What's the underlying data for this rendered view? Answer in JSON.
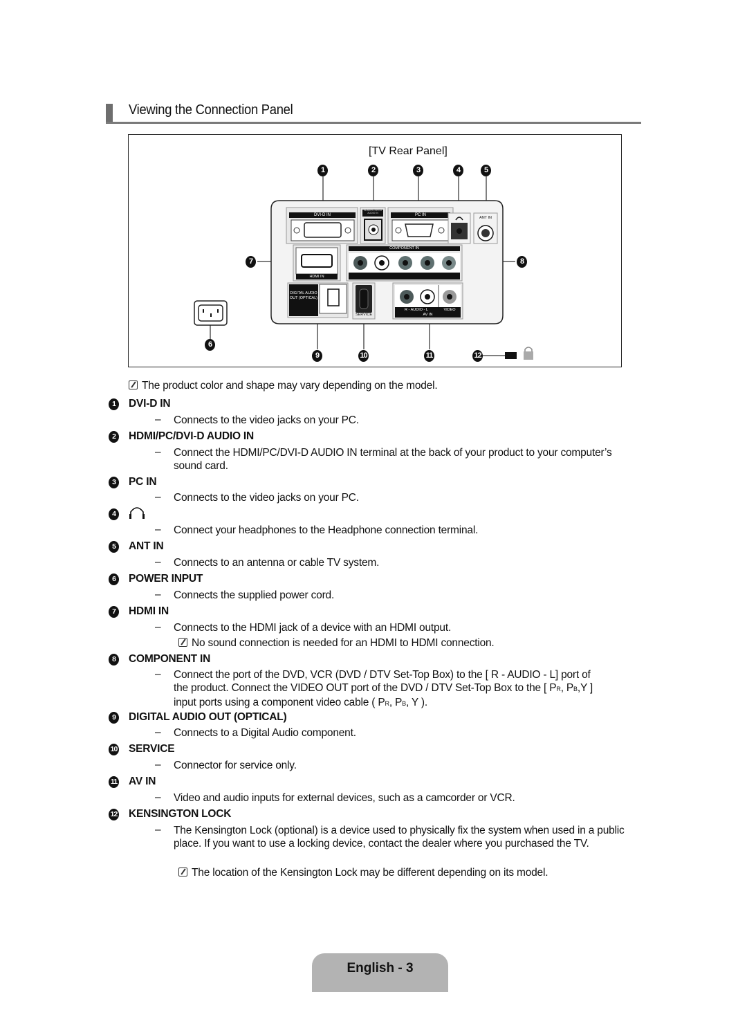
{
  "header": {
    "title": "Viewing the Connection Panel"
  },
  "figure": {
    "caption": "[TV Rear Panel]",
    "callouts": [
      "1",
      "2",
      "3",
      "4",
      "5",
      "6",
      "7",
      "8",
      "9",
      "10",
      "11",
      "12"
    ],
    "panel_labels": {
      "dvi_d_in": "DVI-D IN",
      "hdmi_pc_dvi_audio": "HDMI/PC /DVI-D AUDIO IN",
      "pc_in": "PC IN",
      "ant_in": "ANT IN",
      "component_in": "COMPONENT IN",
      "hdmi_in": "HDMI IN",
      "component_sub": [
        "R",
        "- AUDIO -",
        "L",
        "PR",
        "PB",
        "Y"
      ],
      "digital_audio_out": "DIGITAL AUDIO OUT (OPTICAL)",
      "service": "SERVICE",
      "av_audio": "R - AUDIO - L",
      "av_video": "VIDEO",
      "av_in": "AV IN"
    },
    "note": "The product color and shape may vary depending on the model."
  },
  "sections": [
    {
      "num": "1",
      "title": "DVI-D IN",
      "desc": "Connects to the video jacks on your PC."
    },
    {
      "num": "2",
      "title": "HDMI/PC/DVI-D AUDIO IN",
      "desc": "Connect the HDMI/PC/DVI-D AUDIO IN terminal at the back of your product to your computer’s sound card."
    },
    {
      "num": "3",
      "title": "PC IN",
      "desc": "Connects to the video jacks on your PC."
    },
    {
      "num": "4",
      "title": "headphone-icon",
      "desc": "Connect your headphones to the Headphone connection terminal."
    },
    {
      "num": "5",
      "title": "ANT IN",
      "desc": "Connects to an antenna or cable TV system."
    },
    {
      "num": "6",
      "title": "POWER INPUT",
      "desc": "Connects the supplied power cord."
    },
    {
      "num": "7",
      "title": "HDMI IN",
      "desc": "Connects to the HDMI jack of a device with an HDMI output.",
      "note": "No sound connection is needed for an HDMI to HDMI connection."
    },
    {
      "num": "8",
      "title": "COMPONENT IN",
      "desc_parts": [
        "Connect the port of the DVD, VCR (DVD / DTV Set-Top Box) to the [ R - AUDIO - L] port of",
        "the product. Connect the VIDEO OUT port of the DVD / DTV Set-Top Box to the [ P",
        "R",
        ", P",
        "B",
        ",Y ]",
        "input ports using a component video cable ( P",
        "R",
        ", P",
        "B",
        ", Y )."
      ]
    },
    {
      "num": "9",
      "title": "DIGITAL AUDIO OUT (OPTICAL)",
      "desc": "Connects to a Digital Audio component."
    },
    {
      "num": "10",
      "title": "SERVICE",
      "desc": "Connector for service only."
    },
    {
      "num": "11",
      "title": "AV IN",
      "desc": "Video and audio inputs for external devices, such as a camcorder or VCR."
    },
    {
      "num": "12",
      "title": "KENSINGTON LOCK",
      "desc": "The Kensington Lock (optional) is a device used to physically fix the system when used in a public place. If you want to use a locking device, contact the dealer where you purchased the TV.",
      "note": "The location of the Kensington Lock may be different depending on its model."
    }
  ],
  "dash": "–",
  "footer": {
    "page_label": "English - 3"
  }
}
